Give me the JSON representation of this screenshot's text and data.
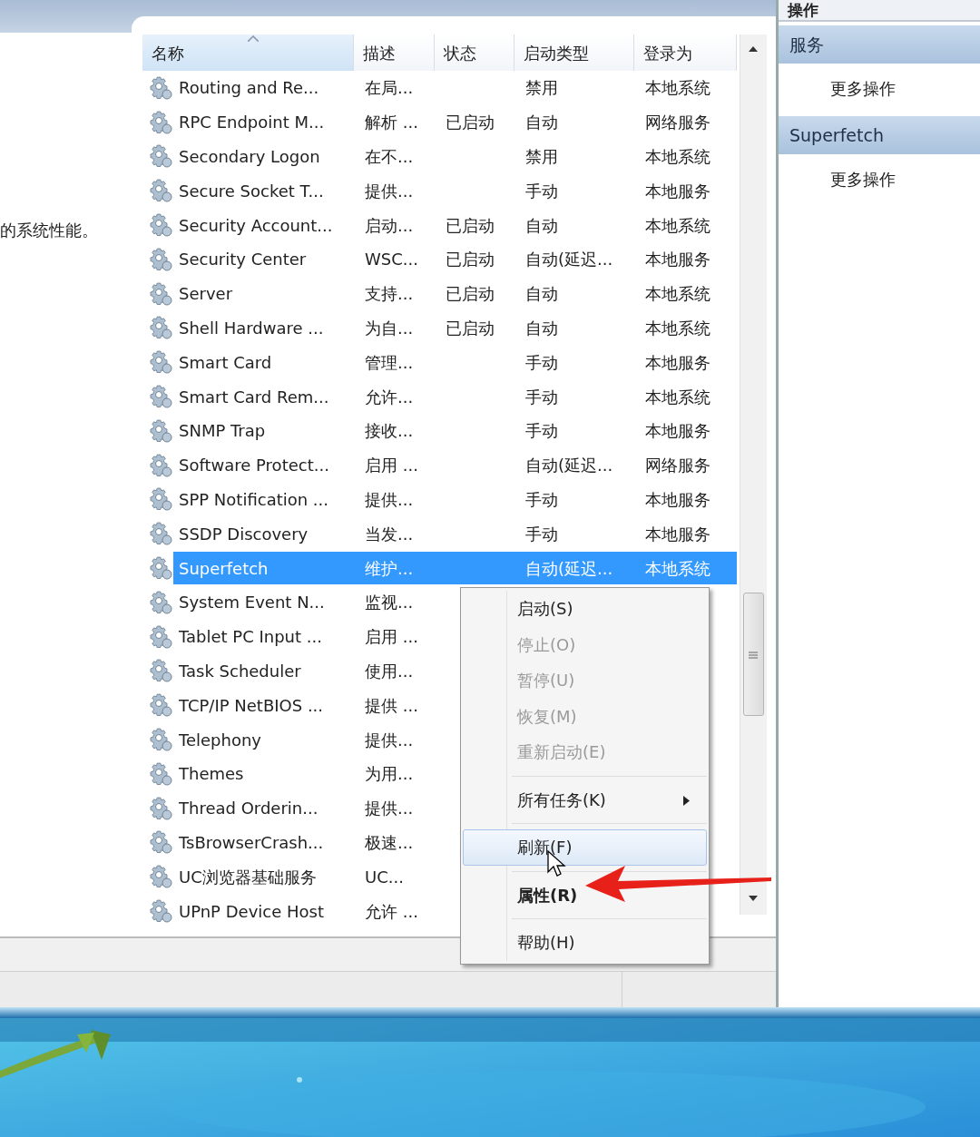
{
  "left_panel": {
    "description_tail": "的系统性能。"
  },
  "table": {
    "columns": [
      {
        "label": "名称",
        "sorted": true
      },
      {
        "label": "描述",
        "sorted": false
      },
      {
        "label": "状态",
        "sorted": false
      },
      {
        "label": "启动类型",
        "sorted": false
      },
      {
        "label": "登录为",
        "sorted": false
      }
    ],
    "rows": [
      {
        "name": "Routing and Re...",
        "description": "在局...",
        "startup_type": "禁用",
        "log_on_as": "本地系统",
        "selected": false
      },
      {
        "name": "RPC Endpoint M...",
        "description": "解析 ...",
        "status": "已启动",
        "startup_type": "自动",
        "log_on_as": "网络服务",
        "selected": false
      },
      {
        "name": "Secondary Logon",
        "description": "在不...",
        "startup_type": "禁用",
        "log_on_as": "本地系统",
        "selected": false
      },
      {
        "name": "Secure Socket T...",
        "description": "提供...",
        "startup_type": "手动",
        "log_on_as": "本地服务",
        "selected": false
      },
      {
        "name": "Security Account...",
        "description": "启动...",
        "status": "已启动",
        "startup_type": "自动",
        "log_on_as": "本地系统",
        "selected": false
      },
      {
        "name": "Security Center",
        "description": "WSC...",
        "status": "已启动",
        "startup_type": "自动(延迟...",
        "log_on_as": "本地服务",
        "selected": false
      },
      {
        "name": "Server",
        "description": "支持...",
        "status": "已启动",
        "startup_type": "自动",
        "log_on_as": "本地系统",
        "selected": false
      },
      {
        "name": "Shell Hardware ...",
        "description": "为自...",
        "status": "已启动",
        "startup_type": "自动",
        "log_on_as": "本地系统",
        "selected": false
      },
      {
        "name": "Smart Card",
        "description": "管理...",
        "startup_type": "手动",
        "log_on_as": "本地服务",
        "selected": false
      },
      {
        "name": "Smart Card Rem...",
        "description": "允许...",
        "startup_type": "手动",
        "log_on_as": "本地系统",
        "selected": false
      },
      {
        "name": "SNMP Trap",
        "description": "接收...",
        "startup_type": "手动",
        "log_on_as": "本地服务",
        "selected": false
      },
      {
        "name": "Software Protect...",
        "description": "启用 ...",
        "startup_type": "自动(延迟...",
        "log_on_as": "网络服务",
        "selected": false
      },
      {
        "name": "SPP Notification ...",
        "description": "提供...",
        "startup_type": "手动",
        "log_on_as": "本地服务",
        "selected": false
      },
      {
        "name": "SSDP Discovery",
        "description": "当发...",
        "startup_type": "手动",
        "log_on_as": "本地服务",
        "selected": false
      },
      {
        "name": "Superfetch",
        "description": "维护...",
        "startup_type": "自动(延迟...",
        "log_on_as": "本地系统",
        "selected": true
      },
      {
        "name": "System Event N...",
        "description": "监视...",
        "selected": false
      },
      {
        "name": "Tablet PC Input ...",
        "description": "启用 ...",
        "selected": false
      },
      {
        "name": "Task Scheduler",
        "description": "使用...",
        "selected": false
      },
      {
        "name": "TCP/IP NetBIOS ...",
        "description": "提供 ...",
        "selected": false
      },
      {
        "name": "Telephony",
        "description": "提供...",
        "selected": false
      },
      {
        "name": "Themes",
        "description": "为用...",
        "selected": false
      },
      {
        "name": "Thread Orderin...",
        "description": "提供...",
        "selected": false
      },
      {
        "name": "TsBrowserCrash...",
        "description": "极速...",
        "selected": false
      },
      {
        "name": "UC浏览器基础服务",
        "description": "UC...",
        "selected": false
      },
      {
        "name": "UPnP Device Host",
        "description": "允许 ...",
        "selected": false
      }
    ]
  },
  "actions_panel": {
    "title": "操作",
    "sections": [
      {
        "header": "服务",
        "items": [
          "更多操作"
        ]
      },
      {
        "header": "Superfetch",
        "items": [
          "更多操作"
        ]
      }
    ]
  },
  "context_menu": {
    "items": [
      {
        "kind": "item",
        "label": "启动(S)",
        "disabled": false,
        "bold": false,
        "highlighted": false
      },
      {
        "kind": "item",
        "label": "停止(O)",
        "disabled": true,
        "bold": false,
        "highlighted": false
      },
      {
        "kind": "item",
        "label": "暂停(U)",
        "disabled": true,
        "bold": false,
        "highlighted": false
      },
      {
        "kind": "item",
        "label": "恢复(M)",
        "disabled": true,
        "bold": false,
        "highlighted": false
      },
      {
        "kind": "item",
        "label": "重新启动(E)",
        "disabled": true,
        "bold": false,
        "highlighted": false
      },
      {
        "kind": "separator"
      },
      {
        "kind": "submenu",
        "label": "所有任务(K)",
        "disabled": false,
        "bold": false,
        "highlighted": false
      },
      {
        "kind": "separator"
      },
      {
        "kind": "item",
        "label": "刷新(F)",
        "disabled": false,
        "bold": false,
        "highlighted": true
      },
      {
        "kind": "separator"
      },
      {
        "kind": "item",
        "label": "属性(R)",
        "disabled": false,
        "bold": true,
        "highlighted": false
      },
      {
        "kind": "separator"
      },
      {
        "kind": "item",
        "label": "帮助(H)",
        "disabled": false,
        "bold": false,
        "highlighted": false
      }
    ]
  }
}
